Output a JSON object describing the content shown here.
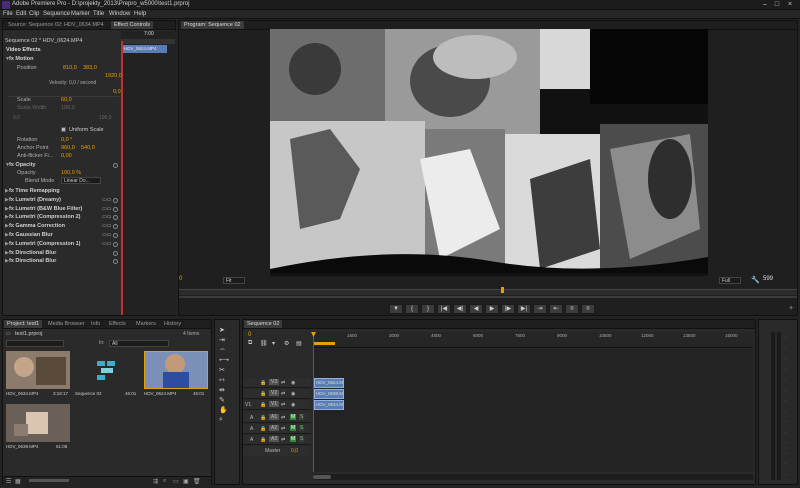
{
  "window": {
    "title": "Adobe Premiere Pro - D:\\projekty_2013\\Prepro_w5000\\test1.prproj"
  },
  "menu": [
    "File",
    "Edit",
    "Clip",
    "Sequence",
    "Marker",
    "Title",
    "Window",
    "Help"
  ],
  "source_panel": {
    "tabs": [
      "Source: Sequence 02: HDV_0634.MP4",
      "Effect Controls"
    ],
    "sequence_label": "Sequence 02 * HDV_0624.MP4",
    "clip_tag": "HDV_0624.MP4",
    "time_hint": "7:00",
    "video_effects_label": "Video Effects",
    "motion": {
      "label": "Motion",
      "position_label": "Position",
      "position_x": "810,0",
      "position_y": "383,0",
      "velocity": "Velocity: 0,0 / second",
      "graph_top": "1920,0",
      "graph_bottom": "0,0",
      "scale_label": "Scale",
      "scale_val": "60,0",
      "scale_width_label": "Scale Width",
      "scale_width_val": "100,0",
      "scale_lo": "0,0",
      "scale_hi": "100,0",
      "uniform_label": "Uniform Scale",
      "rotation_label": "Rotation",
      "rotation_val": "0,0 °",
      "anchor_label": "Anchor Point",
      "anchor_x": "960,0",
      "anchor_y": "540,0",
      "flicker_label": "Anti-flicker Fi...",
      "flicker_val": "0,00"
    },
    "opacity": {
      "label": "Opacity",
      "opacity_label": "Opacity",
      "opacity_val": "100,0 %",
      "blend_label": "Blend Mode",
      "blend_val": "Linear Do..."
    },
    "effects": [
      "Time Remapping",
      "Lumetri (Dreamy)",
      "Lumetri (B&W Blue Filter)",
      "Lumetri (Compression 2)",
      "Gamma Correction",
      "Gaussian Blur",
      "Lumetri (Compression 1)",
      "Directional Blur",
      "Directional Blur"
    ],
    "fx_prefix": "fx"
  },
  "program_panel": {
    "tab": "Program: Sequence 02",
    "fit_label": "Fit",
    "full_label": "Full",
    "time_left": "0",
    "time_right": "599",
    "transport": [
      "▼",
      "{",
      "}",
      "|◀",
      "◀|",
      "◀",
      "▶",
      "|▶",
      "▶|",
      "⇥",
      "⇤",
      "⌾",
      "⌾"
    ]
  },
  "project_panel": {
    "tabs": [
      "Project: test1",
      "Media Browser",
      "Info",
      "Effects",
      "Markers",
      "History"
    ],
    "project_file": "test1.prproj",
    "in_label": "In:",
    "in_value": "All",
    "items_count": "4 Items",
    "items": [
      {
        "name": "HDV_0634.MP4",
        "dur": "3:18:17"
      },
      {
        "name": "Sequence 02",
        "dur": "46:01"
      },
      {
        "name": "HDV_0624.MP4",
        "dur": "46:01"
      },
      {
        "name": "HDV_0638.MP4",
        "dur": "51:08"
      }
    ]
  },
  "timeline": {
    "tab": "Sequence 02",
    "timecode": "0",
    "ruler": [
      "1500",
      "3000",
      "4500",
      "6000",
      "7500",
      "9000",
      "10500",
      "12000",
      "13500",
      "15000"
    ],
    "video_tracks": [
      {
        "name": "V3",
        "clip": "HDV_0624.MP4"
      },
      {
        "name": "V2",
        "clip": "HDV_0638.MP4"
      },
      {
        "name": "V1",
        "src": "V1",
        "clip": "HDV_0634.MP4"
      }
    ],
    "audio_tracks": [
      {
        "name": "A1",
        "m": "M",
        "s": "S"
      },
      {
        "name": "A2",
        "m": "M",
        "s": "S"
      },
      {
        "name": "A3",
        "m": "M",
        "s": "S"
      }
    ],
    "master_label": "Master",
    "master_val": "0,0"
  },
  "colors": {
    "accent": "#e8a000",
    "clip_blue": "#5a7db3",
    "playhead": "#c03030"
  }
}
